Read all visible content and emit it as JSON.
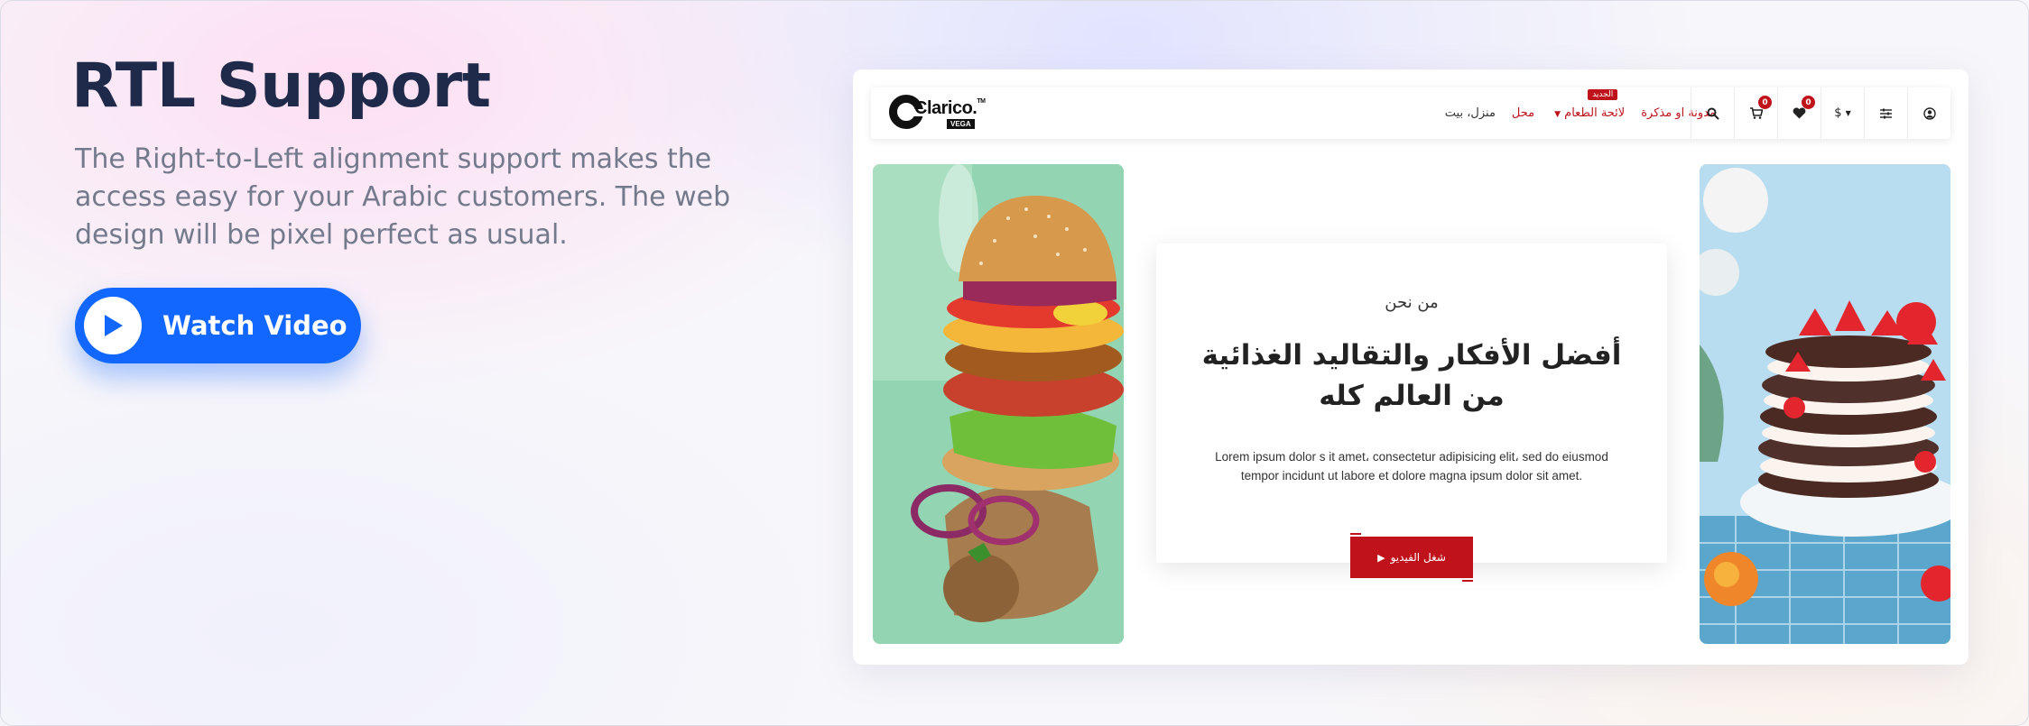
{
  "hero": {
    "title": "RTL Support",
    "description": "The Right-to-Left alignment support makes the access easy for your Arabic customers. The web design will be pixel perfect as usual.",
    "watch_button": "Watch Video"
  },
  "mock_site": {
    "logo": {
      "brand": "Clarico.",
      "tm": "TM",
      "sub": "VEGA"
    },
    "menu": {
      "home": "منزل، بيت",
      "shop": "محل",
      "food_menu": "لائحة الطعام",
      "food_menu_badge": "الجديد",
      "blog": "مدونة او مذكرة"
    },
    "header_icons": {
      "currency": "$",
      "cart_count": "0",
      "wishlist_count": "0"
    },
    "card": {
      "about": "من نحن",
      "headline": "أفضل الأفكار والتقاليد الغذائية من العالم كله",
      "body": "Lorem ipsum dolor s it amet، consectetur adipisicing elit، sed do eiusmod tempor incidunt ut labore et dolore magna ipsum dolor sit amet.",
      "video_button": "شغل الفيديو"
    }
  },
  "colors": {
    "accent_blue": "#1167ff",
    "brand_red": "#c0121a",
    "title_navy": "#1f2a4a"
  }
}
